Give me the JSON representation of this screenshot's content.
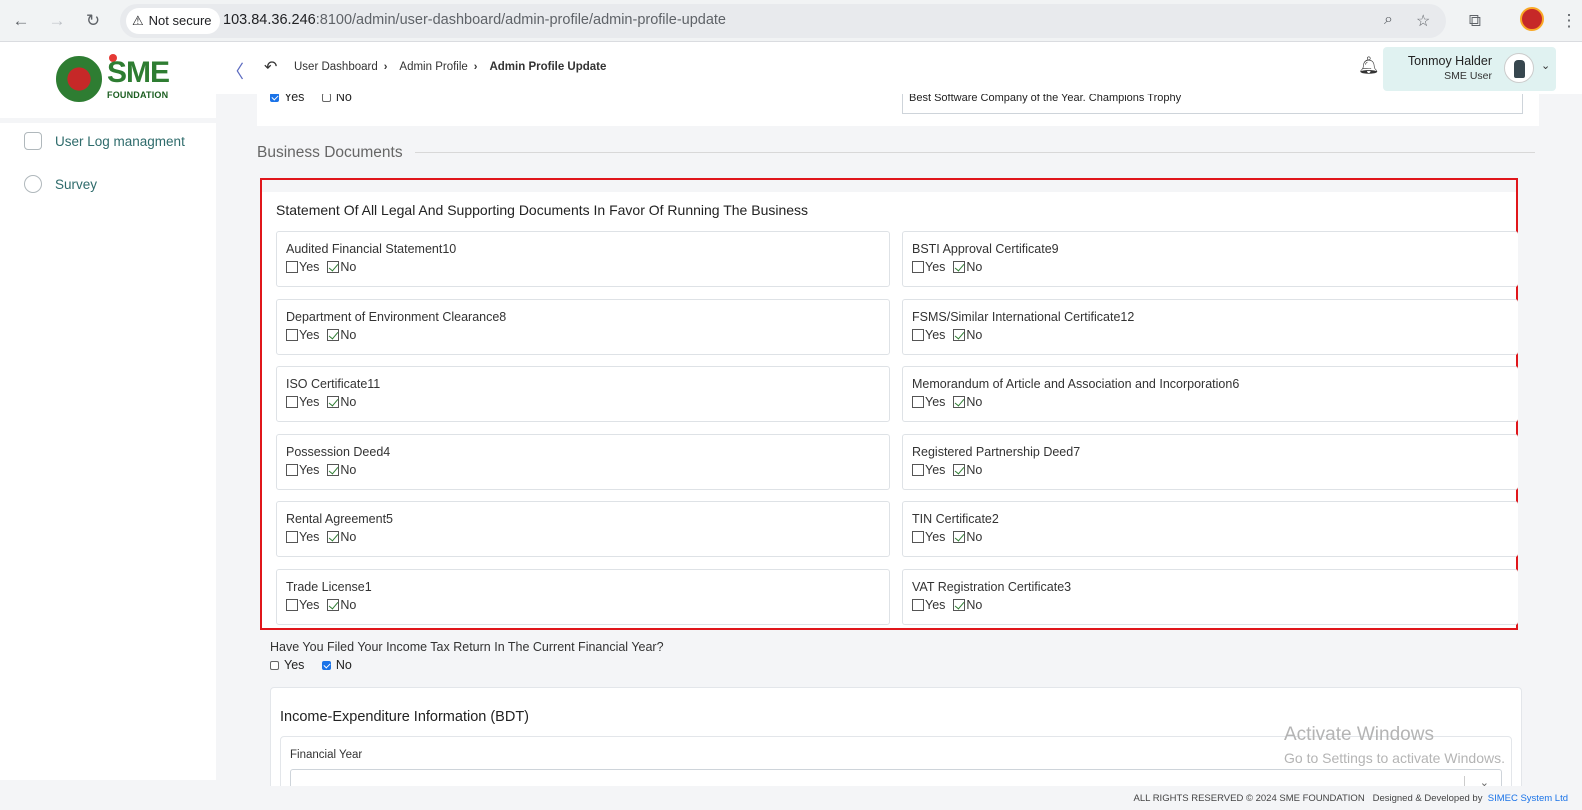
{
  "browser": {
    "security_label": "Not secure",
    "url_host": "103.84.36.246",
    "url_rest": ":8100/admin/user-dashboard/admin-profile/admin-profile-update"
  },
  "logo": {
    "brand": "SME",
    "sub": "FOUNDATION"
  },
  "sidebar": {
    "items": [
      {
        "label": "User Log managment",
        "icon": "log-icon"
      },
      {
        "label": "Survey",
        "icon": "pie-chart-icon"
      }
    ]
  },
  "header": {
    "breadcrumb": [
      "User Dashboard",
      "Admin Profile",
      "Admin Profile Update"
    ],
    "user_name": "Tonmoy Halder",
    "user_role": "SME User"
  },
  "top_section": {
    "yes_label": "Yes",
    "no_label": "No",
    "yes_checked": true,
    "no_checked": false,
    "award_value": "Best Software Company of the Year.  Champions Trophy"
  },
  "business_documents": {
    "section_title": "Business Documents",
    "card_title": "Statement Of All Legal And Supporting Documents In Favor Of Running The Business",
    "yes_label": "Yes",
    "no_label": "No",
    "documents": [
      {
        "label": "Audited Financial Statement10",
        "value": "No"
      },
      {
        "label": "BSTI Approval Certificate9",
        "value": "No"
      },
      {
        "label": "Department of Environment Clearance8",
        "value": "No"
      },
      {
        "label": "FSMS/Similar International Certificate12",
        "value": "No"
      },
      {
        "label": "ISO Certificate11",
        "value": "No"
      },
      {
        "label": "Memorandum of Article and Association and Incorporation6",
        "value": "No"
      },
      {
        "label": "Possession Deed4",
        "value": "No"
      },
      {
        "label": "Registered Partnership Deed7",
        "value": "No"
      },
      {
        "label": "Rental Agreement5",
        "value": "No"
      },
      {
        "label": "TIN Certificate2",
        "value": "No"
      },
      {
        "label": "Trade License1",
        "value": "No"
      },
      {
        "label": "VAT Registration Certificate3",
        "value": "No"
      }
    ]
  },
  "tax": {
    "question": "Have You Filed Your Income Tax Return In The Current Financial Year?",
    "yes_label": "Yes",
    "no_label": "No",
    "selected": "No"
  },
  "income": {
    "title": "Income-Expenditure Information (BDT)",
    "financial_year_label": "Financial Year",
    "financial_year_value": ""
  },
  "watermark": {
    "line1": "Activate Windows",
    "line2": "Go to Settings to activate Windows."
  },
  "footer": {
    "rights": "ALL RIGHTS RESERVED © 2024 SME FOUNDATION",
    "designed": "Designed & Developed by",
    "developer": "SIMEC System Ltd"
  },
  "colors": {
    "highlight_border": "#e0161b",
    "accent": "#2e6b6b",
    "check_blue": "#1a73e8"
  }
}
